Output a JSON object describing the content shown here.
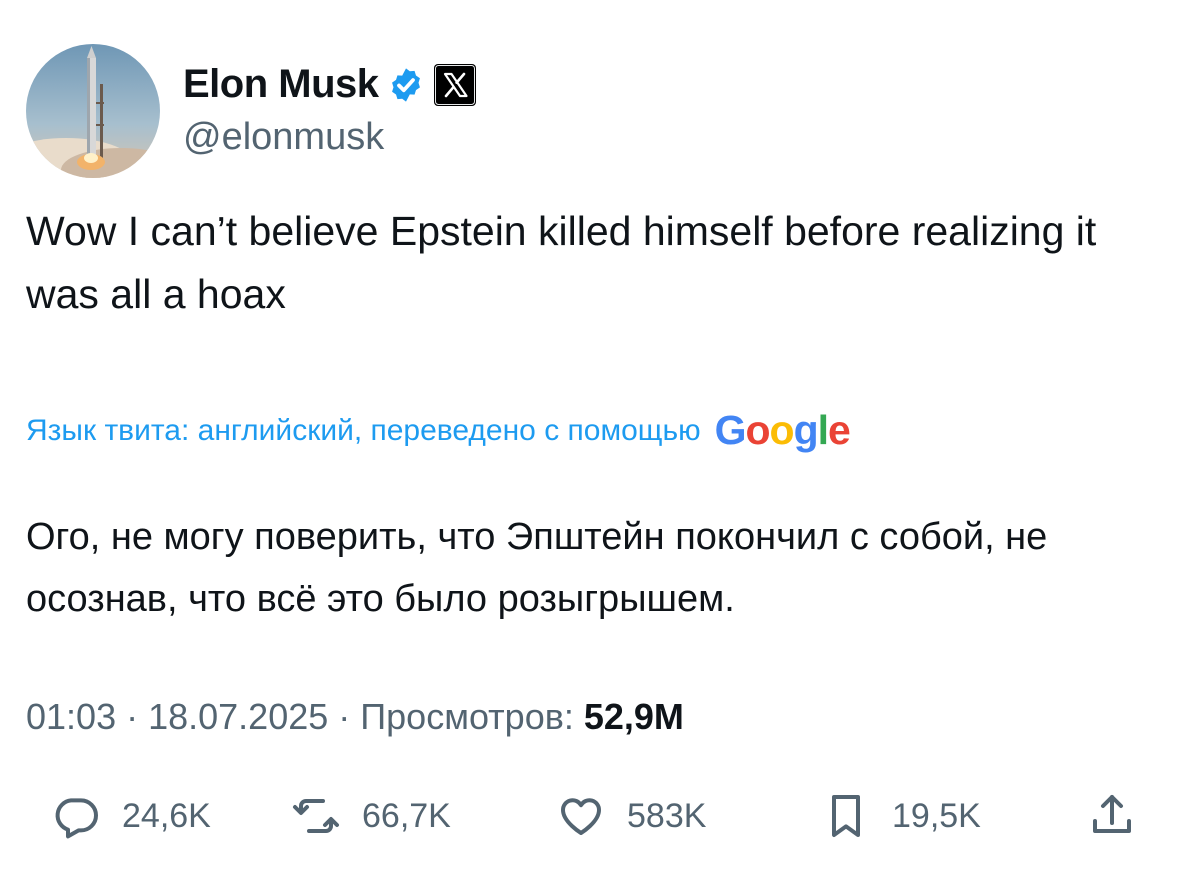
{
  "author": {
    "display_name": "Elon Musk",
    "handle": "@elonmusk",
    "avatar_icon": "rocket-launch-avatar",
    "verified_icon": "verified-badge-icon",
    "affiliate_icon": "x-logo-icon"
  },
  "tweet": {
    "text": "Wow I can’t believe Epstein killed himself before realizing it was all a hoax"
  },
  "translation": {
    "label": "Язык твита: английский, переведено с помощью",
    "provider": "Google",
    "text": "Ого, не могу поверить, что Эпштейн покончил с собой, не осознав, что всё это было розыгрышем."
  },
  "meta": {
    "time": "01:03",
    "separator": " · ",
    "date": "18.07.2025",
    "views_label": "Просмотров:",
    "views_count": "52,9M"
  },
  "actions": {
    "replies": {
      "icon": "reply-icon",
      "count": "24,6K"
    },
    "reposts": {
      "icon": "repost-icon",
      "count": "66,7K"
    },
    "likes": {
      "icon": "heart-icon",
      "count": "583K"
    },
    "bookmarks": {
      "icon": "bookmark-icon",
      "count": "19,5K"
    },
    "share": {
      "icon": "share-icon"
    }
  },
  "colors": {
    "text": "#0f1419",
    "secondary": "#536471",
    "link": "#1d9bf0",
    "verified": "#1d9bf0",
    "background": "#ffffff"
  }
}
